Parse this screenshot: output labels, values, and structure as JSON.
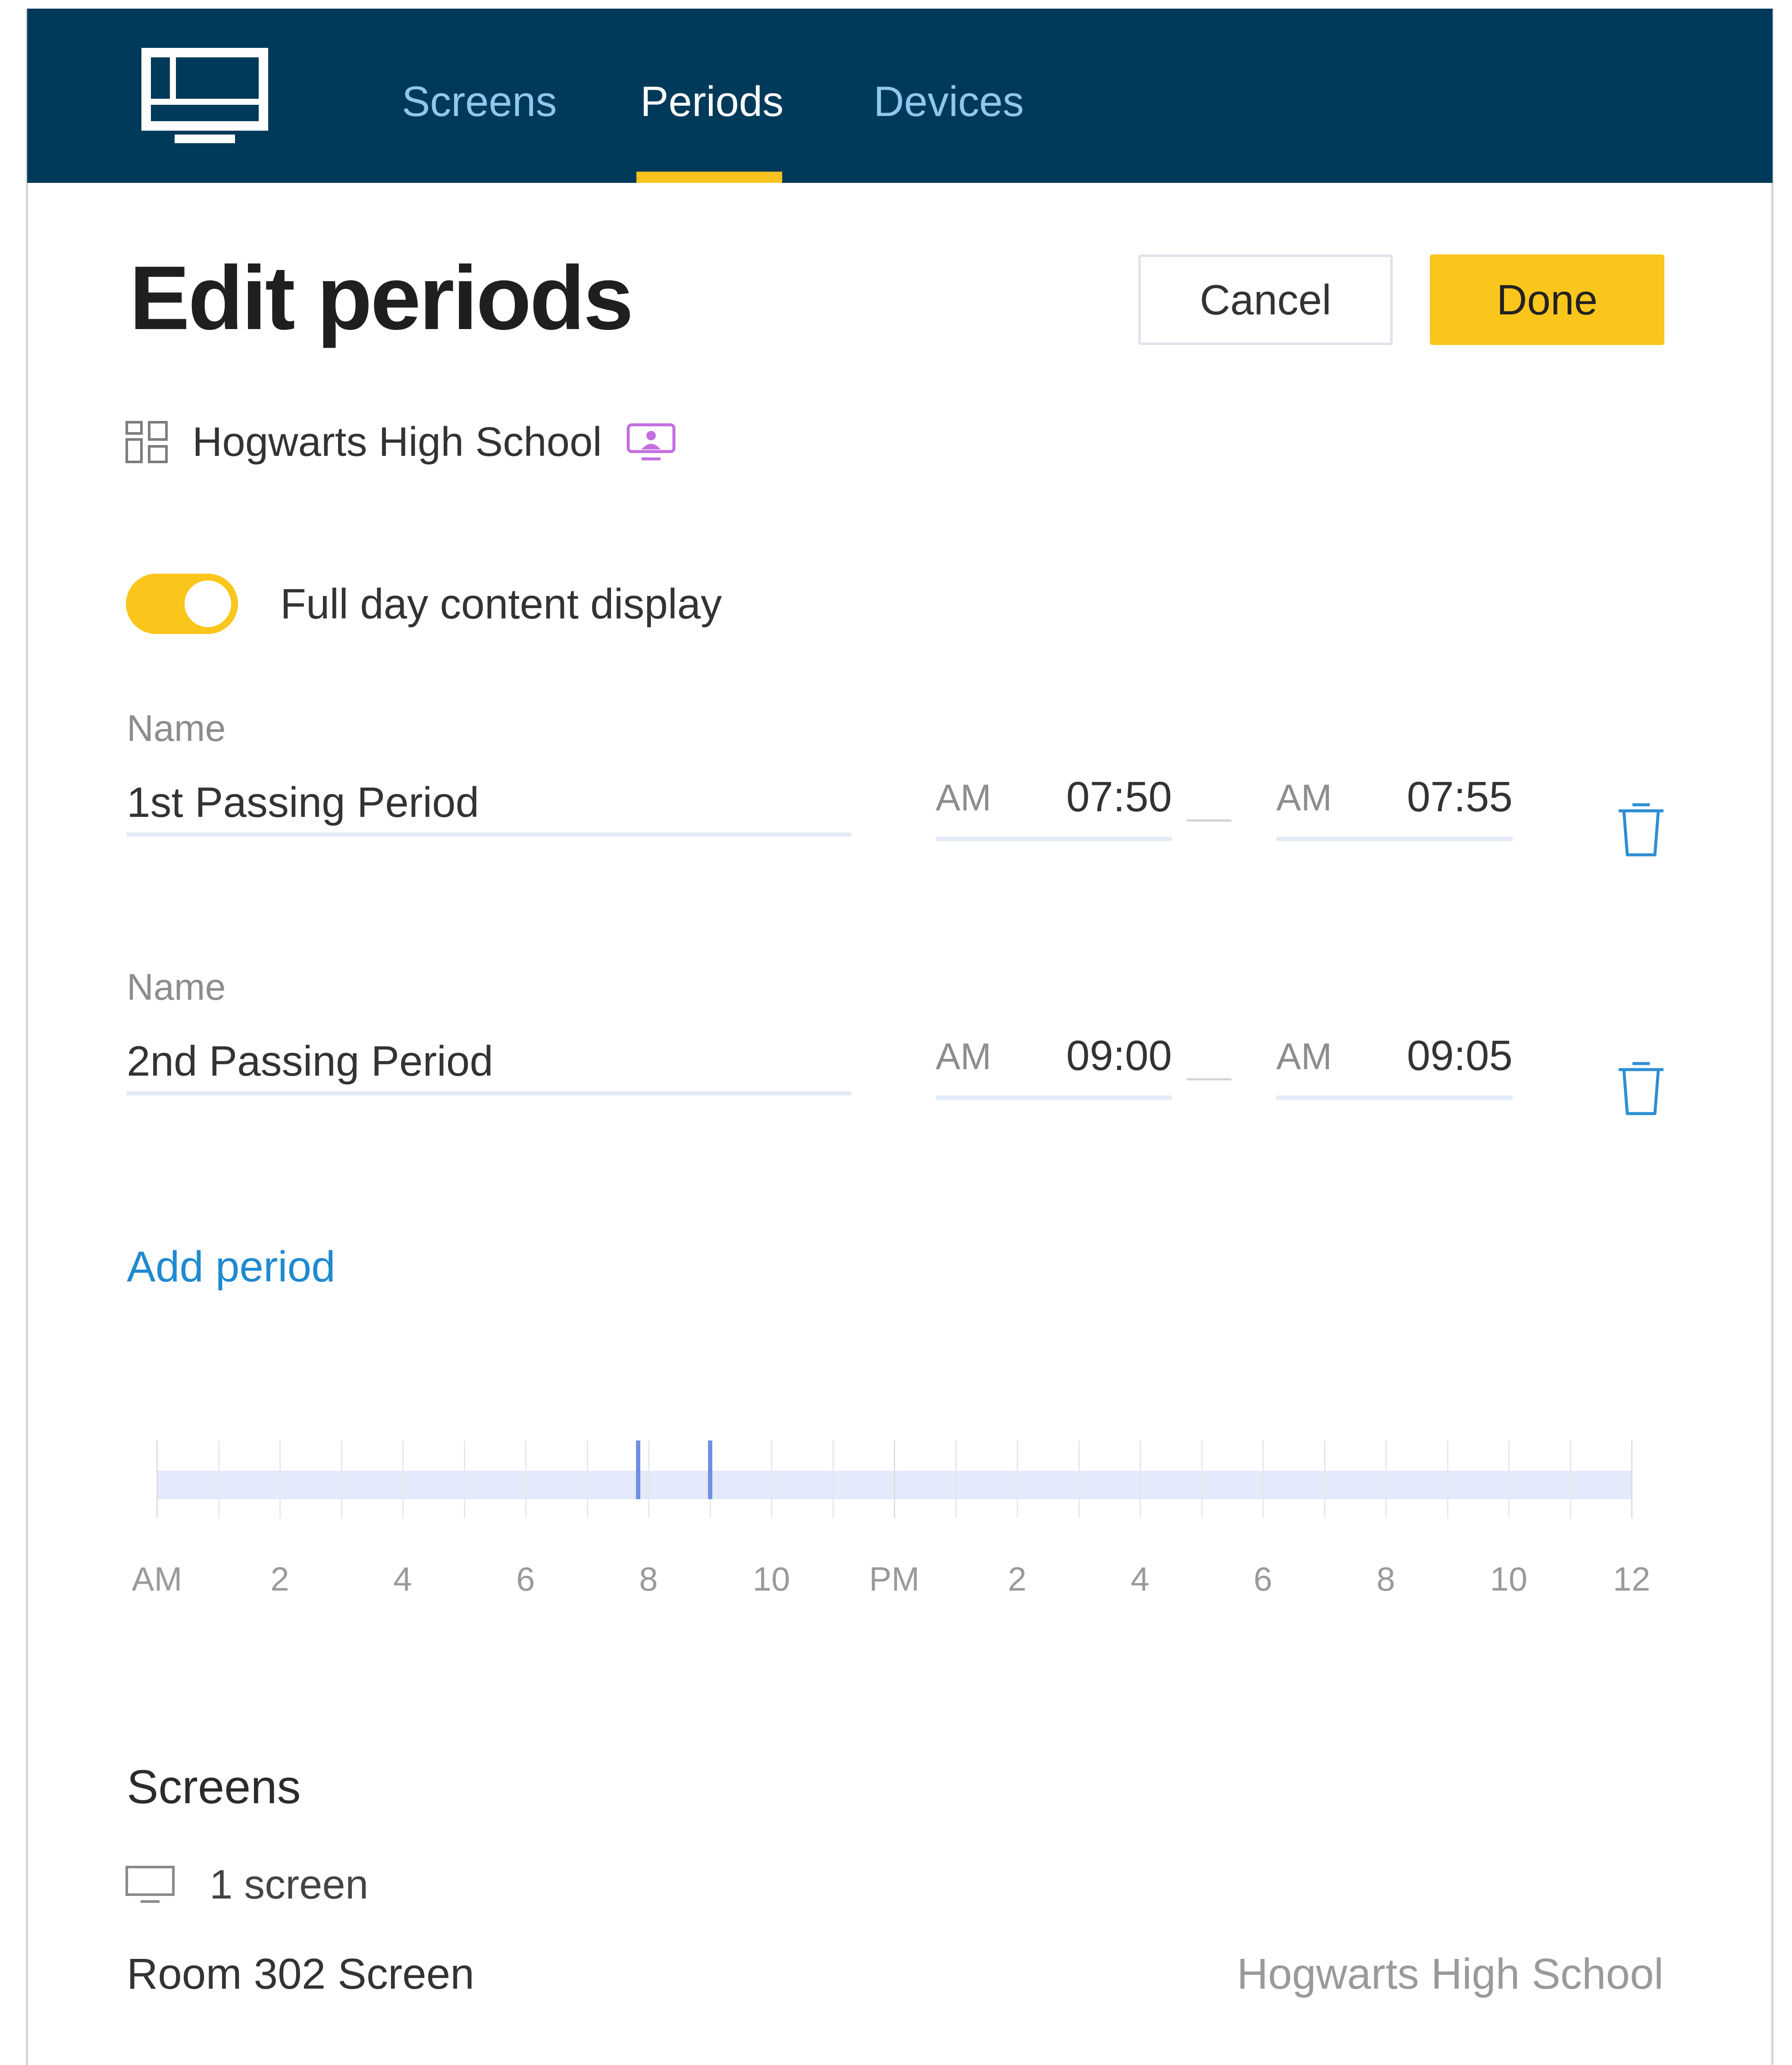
{
  "nav": {
    "tabs": [
      {
        "label": "Screens",
        "active": false
      },
      {
        "label": "Periods",
        "active": true
      },
      {
        "label": "Devices",
        "active": false
      }
    ],
    "logo_icon": "display-logo-icon"
  },
  "header": {
    "title": "Edit periods",
    "cancel_label": "Cancel",
    "done_label": "Done"
  },
  "school": {
    "name": "Hogwarts High School",
    "icon": "layout-grid-icon",
    "badge_icon": "screen-presenter-icon"
  },
  "full_day": {
    "label": "Full day content display",
    "enabled": true
  },
  "periods": [
    {
      "name_label": "Name",
      "name": "1st Passing Period",
      "start_ampm": "AM",
      "start_time": "07:50",
      "end_ampm": "AM",
      "end_time": "07:55"
    },
    {
      "name_label": "Name",
      "name": "2nd Passing Period",
      "start_ampm": "AM",
      "start_time": "09:00",
      "end_ampm": "AM",
      "end_time": "09:05"
    }
  ],
  "add_period_label": "Add period",
  "timeline": {
    "tick_labels": [
      "AM",
      "2",
      "4",
      "6",
      "8",
      "10",
      "PM",
      "2",
      "4",
      "6",
      "8",
      "10",
      "12"
    ],
    "markers_hours": [
      7.83,
      9.0
    ]
  },
  "screens": {
    "title": "Screens",
    "count_label": "1 screen",
    "items": [
      {
        "name": "Room 302 Screen",
        "school": "Hogwarts High School"
      }
    ]
  },
  "colors": {
    "nav_bg": "#003a5a",
    "accent": "#fbc61c",
    "link": "#1f8ad0",
    "badge": "#c46fe0"
  }
}
